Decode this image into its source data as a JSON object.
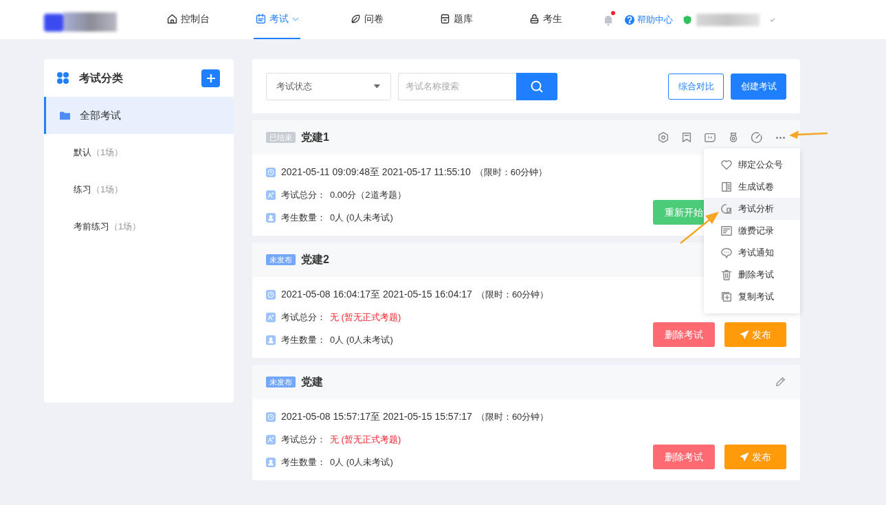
{
  "nav": {
    "items": [
      {
        "label": "控制台",
        "selected": false,
        "dropdown": false
      },
      {
        "label": "考试",
        "selected": true,
        "dropdown": true
      },
      {
        "label": "问卷",
        "selected": false,
        "dropdown": false
      },
      {
        "label": "题库",
        "selected": false,
        "dropdown": false
      },
      {
        "label": "考生",
        "selected": false,
        "dropdown": false
      }
    ],
    "notification_dot": true,
    "help": "帮助中心"
  },
  "sidebar": {
    "title": "考试分类",
    "items": [
      {
        "label": "全部考试",
        "kind": "all",
        "selected": true
      },
      {
        "label": "默认",
        "count": "（1场）",
        "kind": "category",
        "selected": false
      },
      {
        "label": "练习",
        "count": "（1场）",
        "kind": "category",
        "selected": false
      },
      {
        "label": "考前练习",
        "count": "（1场）",
        "kind": "category",
        "selected": false
      }
    ]
  },
  "toolbar": {
    "status_select": {
      "placeholder": "考试状态"
    },
    "search": {
      "placeholder": "考试名称搜索"
    },
    "buttons": [
      {
        "label": "综合对比",
        "kind": "outline"
      },
      {
        "label": "创建考试",
        "kind": "primary"
      }
    ]
  },
  "exams": [
    {
      "status": {
        "label": "已结束",
        "kind": "ended"
      },
      "title": "党建1",
      "tools": {
        "kind": "actions"
      },
      "time_range": "2021-05-11 09:09:48至 2021-05-17 11:55:10",
      "limit": "（限时：60分钟）",
      "score_label": "考试总分：",
      "score": "0.00分（2道考题）",
      "score_missing": false,
      "count_label": "考生数量：",
      "count": "0人 (0人未考试)",
      "buttons": [
        {
          "label": "重新开始",
          "kind": "restart"
        }
      ]
    },
    {
      "status": {
        "label": "未发布",
        "kind": "draft"
      },
      "title": "党建2",
      "time_range": "2021-05-08 16:04:17至 2021-05-15 16:04:17",
      "limit": "（限时：60分钟）",
      "score_label": "考试总分：",
      "score": "无 (暂无正式考题)",
      "score_missing": true,
      "count_label": "考生数量：",
      "count": "0人 (0人未考试)",
      "buttons": [
        {
          "label": "删除考试",
          "kind": "delete"
        },
        {
          "label": "发布",
          "kind": "publish"
        }
      ]
    },
    {
      "status": {
        "label": "未发布",
        "kind": "draft"
      },
      "title": "党建",
      "tools": {
        "kind": "edit"
      },
      "time_range": "2021-05-08 15:57:17至 2021-05-15 15:57:17",
      "limit": "（限时：60分钟）",
      "score_label": "考试总分：",
      "score": "无 (暂无正式考题)",
      "score_missing": true,
      "count_label": "考生数量：",
      "count": "0人 (0人未考试)",
      "buttons": [
        {
          "label": "删除考试",
          "kind": "delete"
        },
        {
          "label": "发布",
          "kind": "publish"
        }
      ]
    }
  ],
  "more_menu": {
    "items": [
      {
        "label": "绑定公众号",
        "selected": false
      },
      {
        "label": "生成试卷",
        "selected": false
      },
      {
        "label": "考试分析",
        "selected": true
      },
      {
        "label": "缴费记录",
        "selected": false
      },
      {
        "label": "考试通知",
        "selected": false
      },
      {
        "label": "删除考试",
        "selected": false
      },
      {
        "label": "复制考试",
        "selected": false
      }
    ]
  }
}
